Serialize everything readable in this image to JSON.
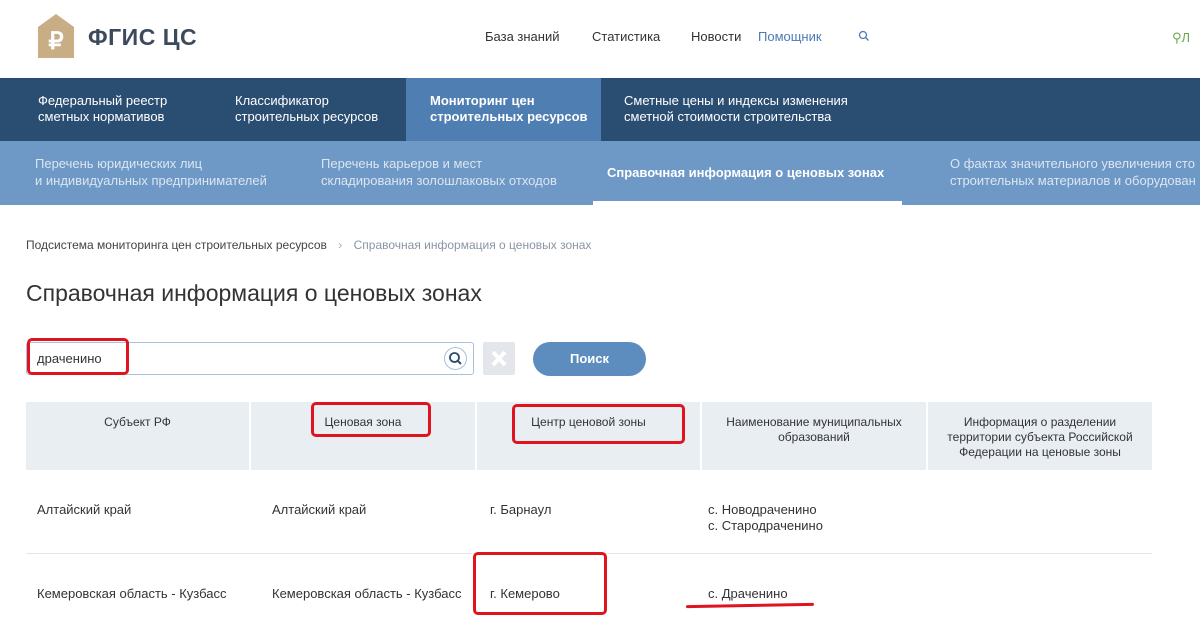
{
  "header": {
    "logo_text": "ФГИС ЦС",
    "nav": [
      "База знаний",
      "Статистика",
      "Новости",
      "Помощник"
    ],
    "user_label": "Л"
  },
  "main_nav": [
    {
      "line1": "Федеральный реестр",
      "line2": "сметных нормативов"
    },
    {
      "line1": "Классификатор",
      "line2": "строительных ресурсов"
    },
    {
      "line1": "Мониторинг цен",
      "line2": "строительных ресурсов"
    },
    {
      "line1": "Сметные цены и индексы изменения",
      "line2": "сметной стоимости строительства"
    }
  ],
  "sub_nav": [
    {
      "line1": "Перечень юридических лиц",
      "line2": "и индивидуальных предпринимателей"
    },
    {
      "line1": "Перечень карьеров и мест",
      "line2": "складирования золошлаковых отходов"
    },
    {
      "line1": "Справочная информация о ценовых зонах",
      "line2": ""
    },
    {
      "line1": "О фактах значительного увеличения сто",
      "line2": "строительных материалов и оборудован"
    }
  ],
  "breadcrumb": {
    "parent": "Подсистема мониторинга цен строительных ресурсов",
    "current": "Справочная информация о ценовых зонах"
  },
  "page_title": "Справочная информация о ценовых зонах",
  "search": {
    "value": "драченино",
    "button_label": "Поиск"
  },
  "table": {
    "headers": [
      {
        "line1": "Субъект РФ",
        "line2": "",
        "line3": ""
      },
      {
        "line1": "Ценовая зона",
        "line2": "",
        "line3": ""
      },
      {
        "line1": "Центр ценовой зоны",
        "line2": "",
        "line3": ""
      },
      {
        "line1": "Наименование муниципальных",
        "line2": "образований",
        "line3": ""
      },
      {
        "line1": "Информация о разделении",
        "line2": "территории субъекта Российской",
        "line3": "Федерации на ценовые зоны"
      }
    ],
    "rows": [
      {
        "subject": "Алтайский край",
        "zone": "Алтайский край",
        "center": "г. Барнаул",
        "municipal1": "с. Новодраченино",
        "municipal2": "с. Стародраченино"
      },
      {
        "subject": "Кемеровская область - Кузбасс",
        "zone": "Кемеровская область - Кузбасс",
        "center": "г. Кемерово",
        "municipal1": "с. Драченино",
        "municipal2": ""
      }
    ]
  },
  "colors": {
    "main_nav_bg": "#2a4d72",
    "main_nav_active": "#4f7fb2",
    "sub_nav_bg": "#6e98c5",
    "button": "#5d8cbf",
    "highlight": "#e0141f"
  }
}
